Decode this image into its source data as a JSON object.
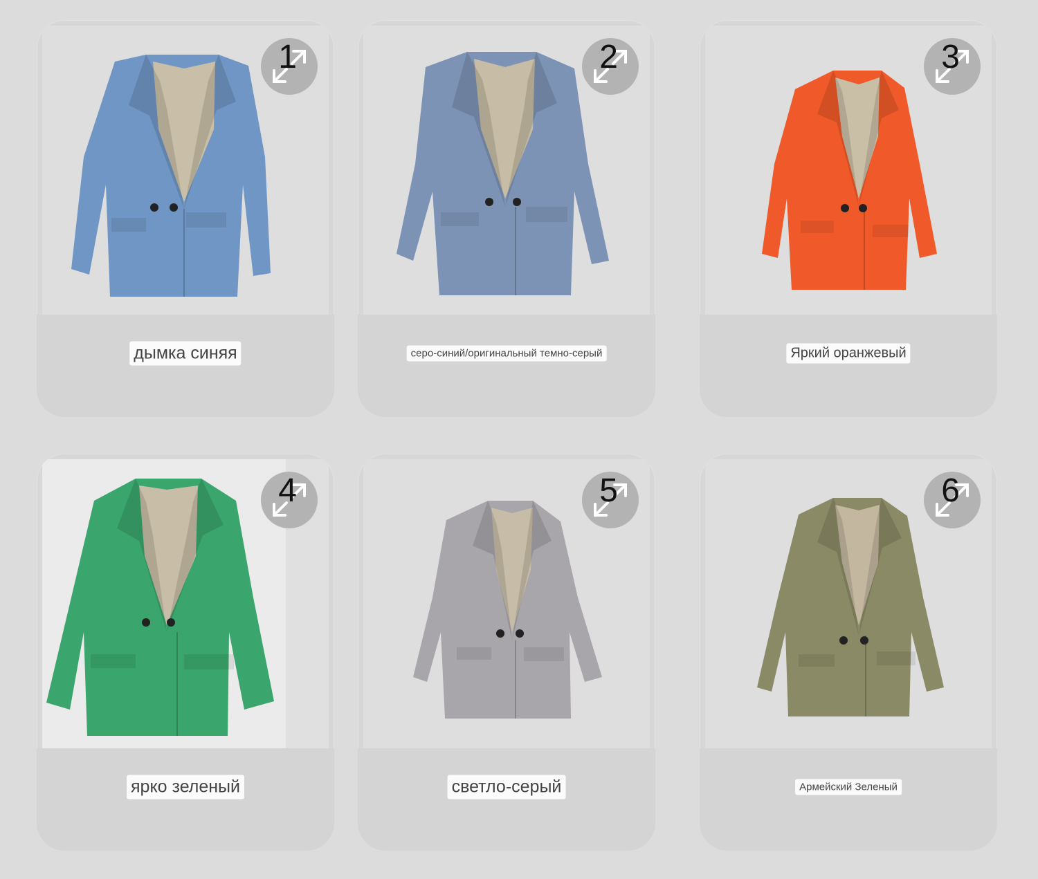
{
  "products": [
    {
      "number": "1",
      "label": "дымка синяя",
      "color": "#6f96c4"
    },
    {
      "number": "2",
      "label": "серо-синий/оригинальный темно-серый",
      "color": "#7d93b5"
    },
    {
      "number": "3",
      "label": "Яркий оранжевый",
      "color": "#f05a2a"
    },
    {
      "number": "4",
      "label": "ярко зеленый",
      "color": "#3aa56c"
    },
    {
      "number": "5",
      "label": "светло-серый",
      "color": "#a8a5ab"
    },
    {
      "number": "6",
      "label": "Армейский Зеленый",
      "color": "#8a8a66"
    }
  ]
}
